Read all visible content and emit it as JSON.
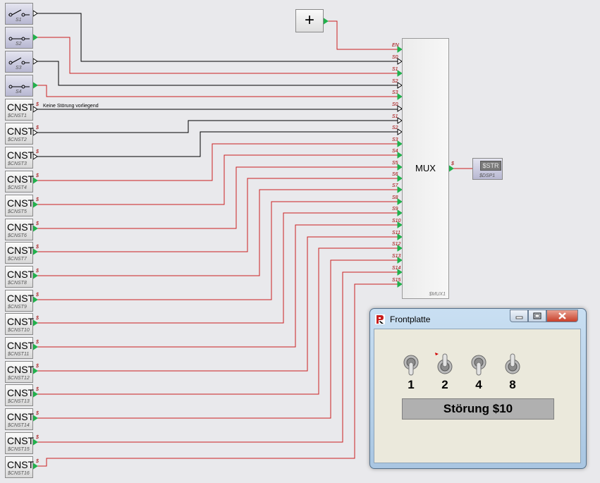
{
  "switches": [
    {
      "sublabel": "S1",
      "state": "open"
    },
    {
      "sublabel": "S2",
      "state": "closed"
    },
    {
      "sublabel": "S3",
      "state": "open"
    },
    {
      "sublabel": "S4",
      "state": "closed"
    }
  ],
  "constants": [
    {
      "label": "CNST",
      "sublabel": "$CNST1"
    },
    {
      "label": "CNST",
      "sublabel": "$CNST2"
    },
    {
      "label": "CNST",
      "sublabel": "$CNST3"
    },
    {
      "label": "CNST",
      "sublabel": "$CNST4"
    },
    {
      "label": "CNST",
      "sublabel": "$CNST5"
    },
    {
      "label": "CNST",
      "sublabel": "$CNST6"
    },
    {
      "label": "CNST",
      "sublabel": "$CNST7"
    },
    {
      "label": "CNST",
      "sublabel": "$CNST8"
    },
    {
      "label": "CNST",
      "sublabel": "$CNST9"
    },
    {
      "label": "CNST",
      "sublabel": "$CNST10"
    },
    {
      "label": "CNST",
      "sublabel": "$CNST11"
    },
    {
      "label": "CNST",
      "sublabel": "$CNST12"
    },
    {
      "label": "CNST",
      "sublabel": "$CNST13"
    },
    {
      "label": "CNST",
      "sublabel": "$CNST14"
    },
    {
      "label": "CNST",
      "sublabel": "$CNST15"
    },
    {
      "label": "CNST",
      "sublabel": "$CNST16"
    }
  ],
  "data_type_label": "$",
  "const1_text": "Keine Störung vorliegend",
  "plus_block": {
    "label": "+"
  },
  "mux": {
    "title": "MUX",
    "sublabel": "$MUX1",
    "inputs": [
      "EN",
      "S0",
      "S1",
      "S2",
      "S3",
      "S0",
      "S1",
      "S2",
      "S3",
      "S4",
      "S5",
      "S6",
      "S7",
      "S8",
      "S9",
      "S10",
      "S11",
      "S12",
      "S13",
      "S14",
      "S15"
    ]
  },
  "display_block": {
    "screen": "$STR",
    "sublabel": "$DSP1"
  },
  "window": {
    "title": "Frontplatte",
    "toggles": [
      {
        "label": "1",
        "state": "down"
      },
      {
        "label": "2",
        "state": "up"
      },
      {
        "label": "4",
        "state": "down"
      },
      {
        "label": "8",
        "state": "up"
      }
    ],
    "display_text": "Störung $10"
  },
  "colors": {
    "wire_red": "#cc2020",
    "wire_black": "#000000",
    "pin_green": "#22b14c",
    "label_red": "#a00000"
  }
}
